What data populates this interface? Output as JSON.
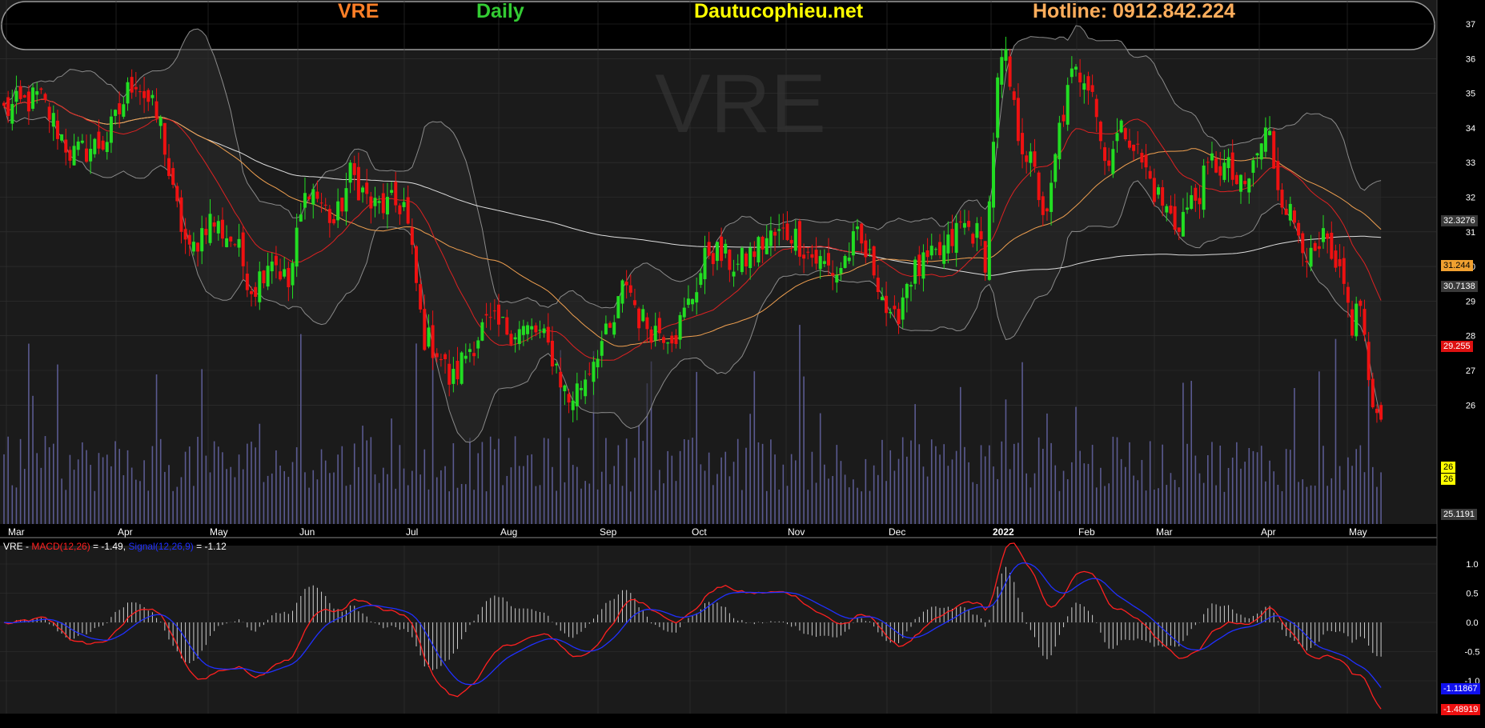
{
  "header": {
    "ticker": "VRE",
    "period": "Daily",
    "site": "Dautucophieu.net",
    "hotline": "Hotline: 0912.842.224",
    "watermark": "VRE"
  },
  "colors": {
    "background": "#000000",
    "panel": "#1b1b1b",
    "grid": "#333333",
    "up": "#22dd22",
    "down": "#ee1111",
    "ma_short": "#dd2222",
    "ma_mid": "#f0a050",
    "ma_long": "#dddddd",
    "bollinger": "#8a8a8a",
    "volume": "#5a5a90",
    "macd": "#ff2020",
    "signal": "#2030ff",
    "ticker_color": "#ff7f27",
    "period_color": "#33cc33",
    "site_color": "#ffff00",
    "hotline_color": "#ffae5c"
  },
  "price_badges": {
    "bb_upper": "32.3276",
    "ma_mid": "31.244",
    "ma_long": "30.7138",
    "ma_short": "29.255",
    "close_a": "26",
    "close_b": "26",
    "bb_lower": "25.1191"
  },
  "macd_legend": {
    "symbol": "VRE - ",
    "macd_label": "MACD(12,26)",
    "macd_value": " = -1.49, ",
    "signal_label": "Signal(12,26,9)",
    "signal_value": " = -1.12"
  },
  "macd_badges": {
    "signal": "-1.11867",
    "macd": "-1.48919"
  },
  "chart_data": [
    {
      "type": "candlestick",
      "title": "VRE",
      "x_tick_labels": [
        "Mar",
        "Apr",
        "May",
        "Jun",
        "Jul",
        "Aug",
        "Sep",
        "Oct",
        "Nov",
        "Dec",
        "2022",
        "Feb",
        "Mar",
        "Apr",
        "May"
      ],
      "y_ticks": [
        26,
        27,
        28,
        29,
        30,
        31,
        32,
        33,
        34,
        35,
        36,
        37
      ],
      "ylim": [
        25,
        37
      ],
      "close_anchors": [
        {
          "m": 0,
          "v": 34.5
        },
        {
          "m": 0.3,
          "v": 34.9
        },
        {
          "m": 0.6,
          "v": 33.2
        },
        {
          "m": 0.9,
          "v": 33.6
        },
        {
          "m": 1.2,
          "v": 35.5
        },
        {
          "m": 1.5,
          "v": 34.0
        },
        {
          "m": 1.6,
          "v": 32.2
        },
        {
          "m": 1.8,
          "v": 30.3
        },
        {
          "m": 2.0,
          "v": 31.4
        },
        {
          "m": 2.3,
          "v": 30.7
        },
        {
          "m": 2.5,
          "v": 29.3
        },
        {
          "m": 2.7,
          "v": 30.4
        },
        {
          "m": 2.9,
          "v": 29.4
        },
        {
          "m": 3.0,
          "v": 31.0
        },
        {
          "m": 3.1,
          "v": 32.4
        },
        {
          "m": 3.35,
          "v": 31.2
        },
        {
          "m": 3.5,
          "v": 32.7
        },
        {
          "m": 3.7,
          "v": 31.7
        },
        {
          "m": 4.0,
          "v": 31.8
        },
        {
          "m": 4.1,
          "v": 30.0
        },
        {
          "m": 4.2,
          "v": 28.0
        },
        {
          "m": 4.35,
          "v": 27.6
        },
        {
          "m": 4.5,
          "v": 26.6
        },
        {
          "m": 4.65,
          "v": 27.5
        },
        {
          "m": 4.85,
          "v": 28.3
        },
        {
          "m": 5.1,
          "v": 28.2
        },
        {
          "m": 5.4,
          "v": 28.1
        },
        {
          "m": 5.55,
          "v": 27.4
        },
        {
          "m": 5.7,
          "v": 26.1
        },
        {
          "m": 5.85,
          "v": 26.7
        },
        {
          "m": 6.0,
          "v": 27.7
        },
        {
          "m": 6.15,
          "v": 28.1
        },
        {
          "m": 6.3,
          "v": 29.7
        },
        {
          "m": 6.45,
          "v": 28.5
        },
        {
          "m": 6.6,
          "v": 28.2
        },
        {
          "m": 6.85,
          "v": 28.1
        },
        {
          "m": 7.0,
          "v": 29.0
        },
        {
          "m": 7.2,
          "v": 30.5
        },
        {
          "m": 7.5,
          "v": 30.0
        },
        {
          "m": 7.8,
          "v": 30.8
        },
        {
          "m": 8.05,
          "v": 31.0
        },
        {
          "m": 8.25,
          "v": 30.3
        },
        {
          "m": 8.5,
          "v": 29.8
        },
        {
          "m": 8.7,
          "v": 30.8
        },
        {
          "m": 8.9,
          "v": 29.8
        },
        {
          "m": 9.05,
          "v": 28.1
        },
        {
          "m": 9.2,
          "v": 29.7
        },
        {
          "m": 9.45,
          "v": 30.2
        },
        {
          "m": 9.6,
          "v": 30.6
        },
        {
          "m": 9.7,
          "v": 31.2
        },
        {
          "m": 9.85,
          "v": 31.0
        },
        {
          "m": 9.95,
          "v": 30.2
        },
        {
          "m": 10.05,
          "v": 34.8
        },
        {
          "m": 10.15,
          "v": 36.2
        },
        {
          "m": 10.3,
          "v": 34.0
        },
        {
          "m": 10.5,
          "v": 32.7
        },
        {
          "m": 10.65,
          "v": 31.2
        },
        {
          "m": 10.8,
          "v": 34.0
        },
        {
          "m": 10.95,
          "v": 35.5
        },
        {
          "m": 11.1,
          "v": 35.6
        },
        {
          "m": 11.2,
          "v": 35.3
        },
        {
          "m": 11.35,
          "v": 33.0
        },
        {
          "m": 11.5,
          "v": 33.7
        },
        {
          "m": 11.65,
          "v": 34.0
        },
        {
          "m": 11.8,
          "v": 33.2
        },
        {
          "m": 12.0,
          "v": 32.2
        },
        {
          "m": 12.2,
          "v": 31.2
        },
        {
          "m": 12.4,
          "v": 32.0
        },
        {
          "m": 12.55,
          "v": 33.0
        },
        {
          "m": 12.7,
          "v": 32.8
        },
        {
          "m": 12.85,
          "v": 32.1
        },
        {
          "m": 13.0,
          "v": 33.4
        },
        {
          "m": 13.1,
          "v": 34.0
        },
        {
          "m": 13.2,
          "v": 32.5
        },
        {
          "m": 13.35,
          "v": 31.5
        },
        {
          "m": 13.5,
          "v": 30.8
        },
        {
          "m": 13.6,
          "v": 30.0
        },
        {
          "m": 13.75,
          "v": 30.8
        },
        {
          "m": 13.85,
          "v": 29.7
        },
        {
          "m": 13.95,
          "v": 29.5
        },
        {
          "m": 14.05,
          "v": 28.3
        },
        {
          "m": 14.15,
          "v": 29.0
        },
        {
          "m": 14.3,
          "v": 25.3
        },
        {
          "m": 14.35,
          "v": 26.0
        }
      ]
    },
    {
      "type": "line",
      "title": "VRE - MACD(12,26) = -1.49, Signal(12,26,9) = -1.12",
      "y_ticks": [
        -1.0,
        -0.5,
        0.0,
        0.5,
        1.0
      ],
      "ylim": [
        -1.6,
        1.3
      ],
      "series": [
        {
          "name": "MACD(12,26)",
          "role": "macd",
          "last": -1.48919
        },
        {
          "name": "Signal(12,26,9)",
          "role": "signal",
          "last": -1.11867
        }
      ]
    }
  ]
}
